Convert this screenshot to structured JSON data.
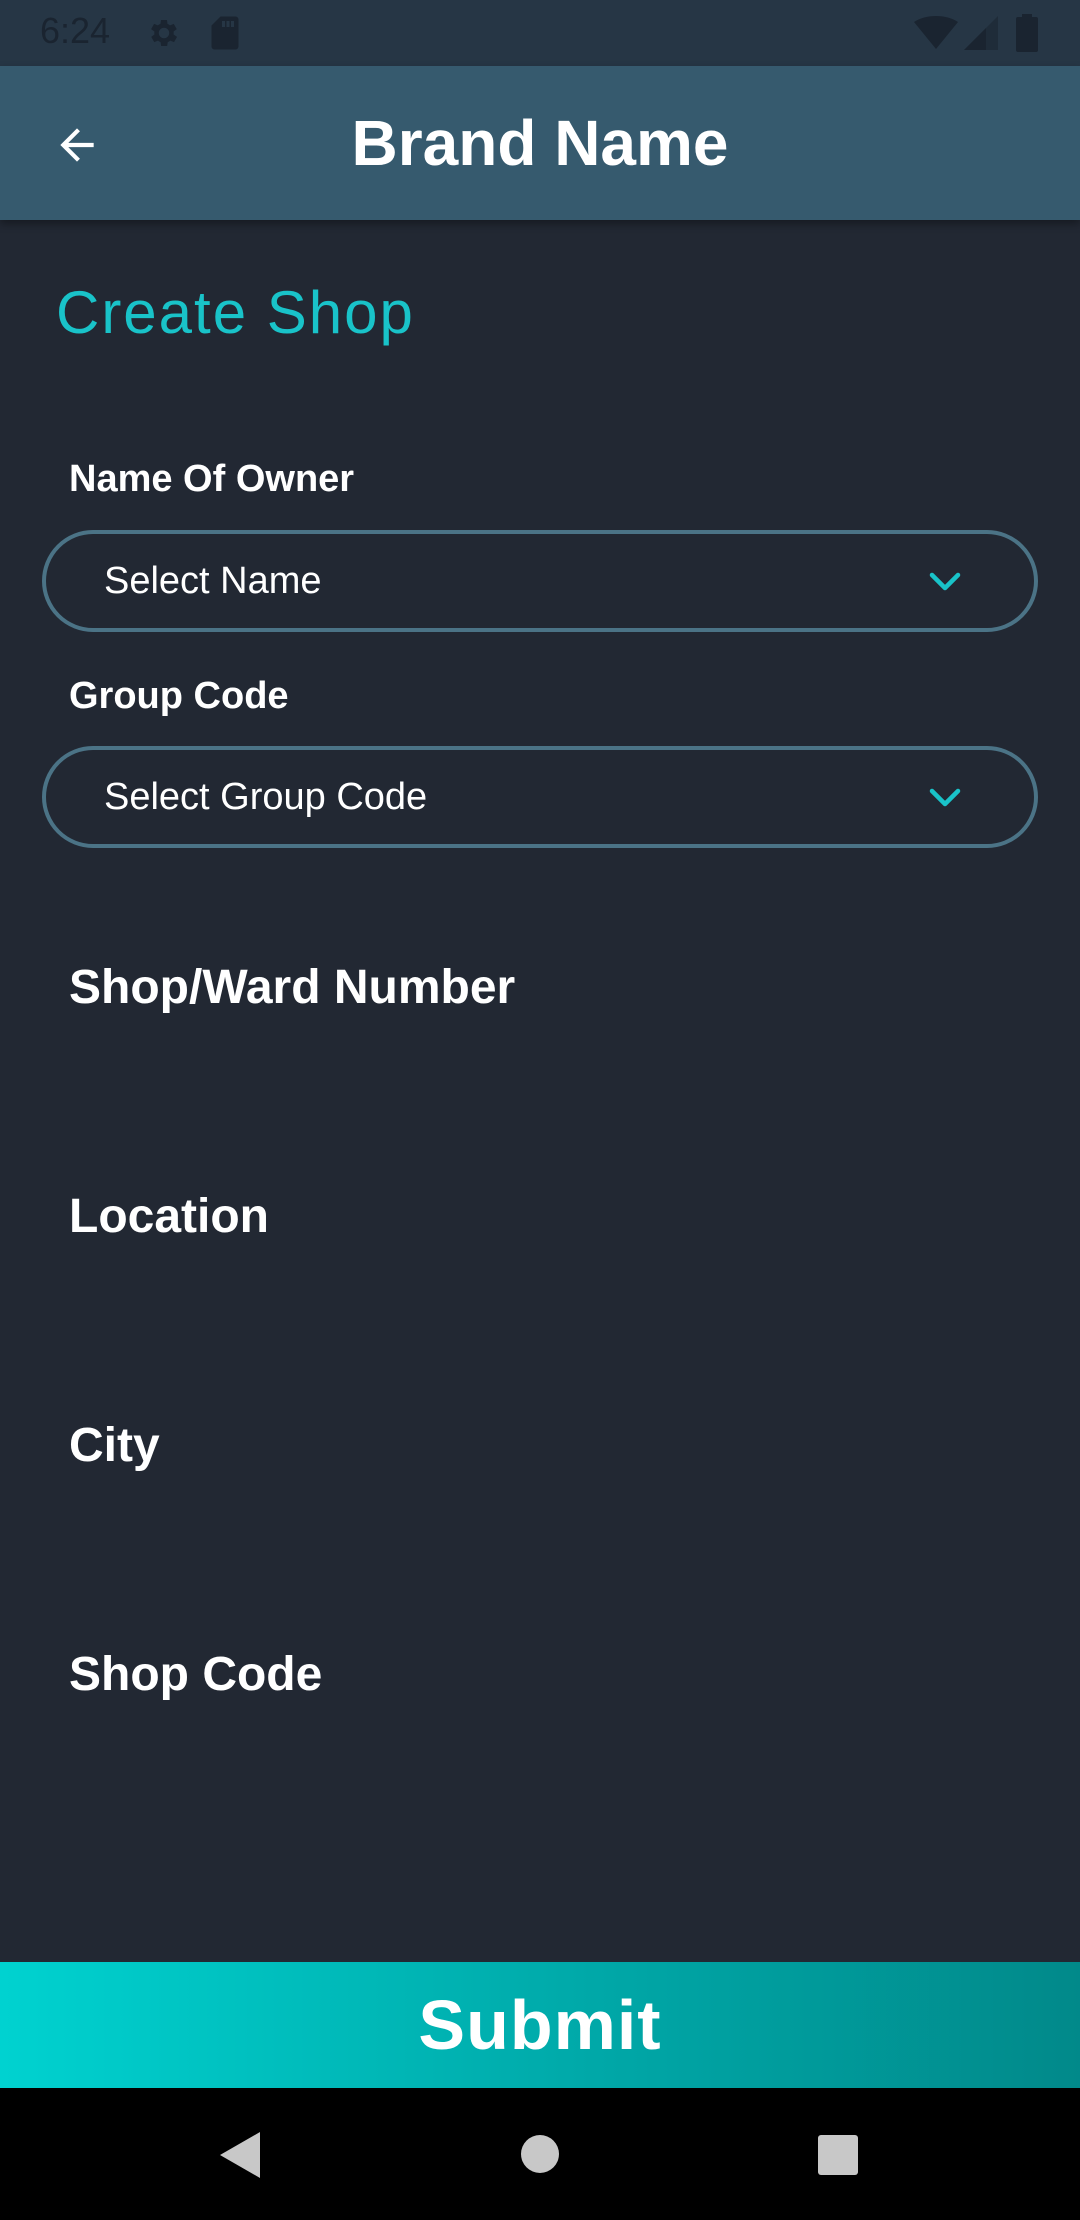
{
  "status_bar": {
    "time": "6:24",
    "icons": [
      "gear-icon",
      "sd-card-icon",
      "wifi-icon",
      "signal-icon",
      "battery-icon"
    ]
  },
  "app_bar": {
    "title": "Brand Name",
    "back_icon": "arrow-left-icon"
  },
  "page": {
    "heading": "Create Shop"
  },
  "form": {
    "owner_label": "Name Of Owner",
    "owner_select": "Select Name",
    "group_label": "Group Code",
    "group_select": "Select Group Code",
    "ward_label": "Shop/Ward Number",
    "location_label": "Location",
    "city_label": "City",
    "shop_code_label": "Shop Code"
  },
  "actions": {
    "submit_label": "Submit"
  },
  "colors": {
    "background": "#222833",
    "app_bar": "#365a6e",
    "accent": "#19c3c9",
    "select_border": "#4b7386"
  }
}
